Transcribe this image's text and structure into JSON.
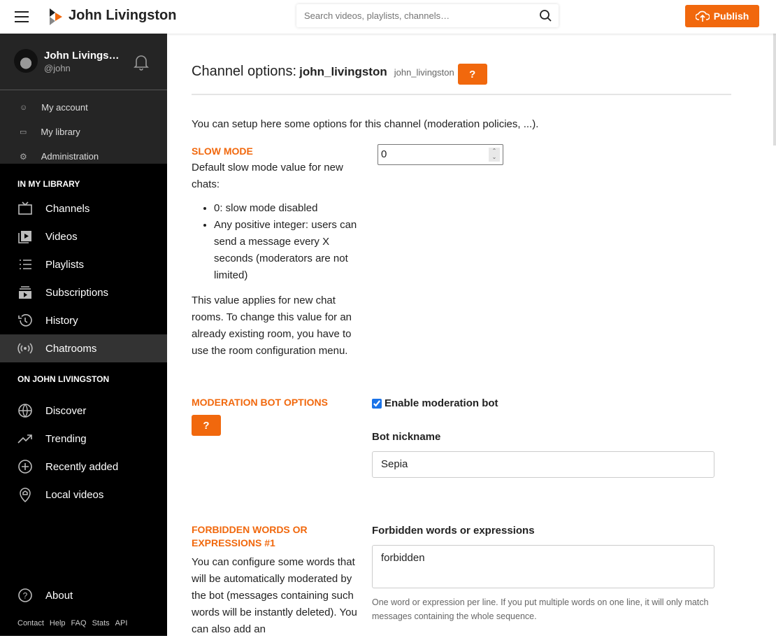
{
  "header": {
    "brand": "John Livingston",
    "search_placeholder": "Search videos, playlists, channels…",
    "publish": "Publish"
  },
  "sidebar": {
    "user": {
      "name": "John Livings…",
      "handle": "@john"
    },
    "user_menu": [
      {
        "label": "My account",
        "icon": "user-icon"
      },
      {
        "label": "My library",
        "icon": "tv-icon"
      },
      {
        "label": "Administration",
        "icon": "gear-icon"
      }
    ],
    "library_title": "IN MY LIBRARY",
    "library": [
      {
        "label": "Channels",
        "icon": "tv-icon"
      },
      {
        "label": "Videos",
        "icon": "video-icon"
      },
      {
        "label": "Playlists",
        "icon": "list-icon"
      },
      {
        "label": "Subscriptions",
        "icon": "subscriptions-icon"
      },
      {
        "label": "History",
        "icon": "history-icon"
      },
      {
        "label": "Chatrooms",
        "icon": "broadcast-icon",
        "active": true
      }
    ],
    "instance_title": "ON JOHN LIVINGSTON",
    "instance": [
      {
        "label": "Discover",
        "icon": "globe-icon"
      },
      {
        "label": "Trending",
        "icon": "trending-icon"
      },
      {
        "label": "Recently added",
        "icon": "plus-circle-icon"
      },
      {
        "label": "Local videos",
        "icon": "home-icon"
      }
    ],
    "about": "About",
    "footer": [
      "Contact",
      "Help",
      "FAQ",
      "Stats",
      "API"
    ]
  },
  "main": {
    "title": "Channel options:",
    "channel": "john_livingston",
    "channel_sub": "john_livingston",
    "help": "?",
    "intro": "You can setup here some options for this channel (moderation policies, ...).",
    "slow": {
      "label": "SLOW MODE",
      "desc": "Default slow mode value for new chats:",
      "bullets": [
        "0: slow mode disabled",
        "Any positive integer: users can send a message every X seconds (moderators are not limited)"
      ],
      "note": "This value applies for new chat rooms. To change this value for an already existing room, you have to use the room configuration menu.",
      "value": "0"
    },
    "bot": {
      "label": "MODERATION BOT OPTIONS",
      "help": "?",
      "enable": "Enable moderation bot",
      "enabled": true,
      "nick_label": "Bot nickname",
      "nick": "Sepia"
    },
    "forbidden": {
      "label": "FORBIDDEN WORDS OR EXPRESSIONS #1",
      "desc": "You can configure some words that will be automatically moderated by the bot (messages containing such words will be instantly deleted). You can also add an",
      "field_label": "Forbidden words or expressions",
      "value": "forbidden",
      "hint": "One word or expression per line. If you put multiple words on one line, it will only match messages containing the whole sequence."
    }
  },
  "colors": {
    "accent": "#f1680d"
  }
}
